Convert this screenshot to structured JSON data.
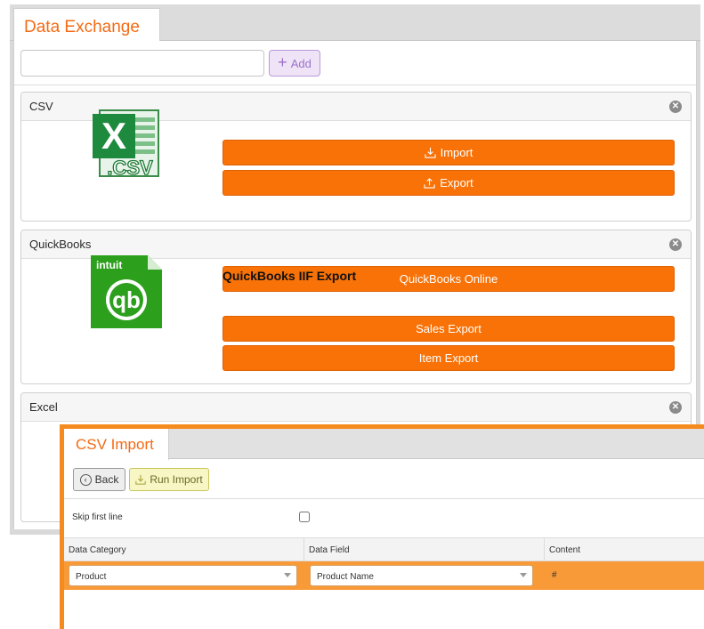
{
  "back_window": {
    "tab_title": "Data Exchange",
    "search": {
      "value": "",
      "placeholder": ""
    },
    "add_label": "Add",
    "panels": {
      "csv": {
        "title": "CSV",
        "logo_text": ".CSV",
        "buttons": {
          "import": "Import",
          "export": "Export"
        }
      },
      "quickbooks": {
        "title": "QuickBooks",
        "logo_text": "intuit",
        "logo_mark": "qb",
        "online_button": "QuickBooks Online",
        "iif_heading": "QuickBooks IIF Export",
        "buttons": {
          "sales_export": "Sales Export",
          "item_export": "Item Export"
        }
      },
      "excel": {
        "title": "Excel"
      }
    }
  },
  "front_window": {
    "tab_title": "CSV Import",
    "back_label": "Back",
    "run_import_label": "Run Import",
    "skip_first_line_label": "Skip first line",
    "skip_first_line_checked": false,
    "columns": [
      "Data Category",
      "Data Field",
      "Content"
    ],
    "mapping_row": {
      "category": "Product",
      "field": "Product Name",
      "content": "#"
    }
  },
  "colors": {
    "accent_orange": "#f87208",
    "tab_text_orange": "#f36b14",
    "add_button_purple": "#9c72c8",
    "run_import_yellow": "#f7f6c4",
    "window_frame_orange": "#f58a1e"
  },
  "icons": {
    "add": "plus-icon",
    "close": "close-circle-icon",
    "import": "download-icon",
    "export": "upload-icon",
    "back": "back-circle-icon",
    "run_import": "download-icon",
    "select": "chevron-down-icon"
  }
}
